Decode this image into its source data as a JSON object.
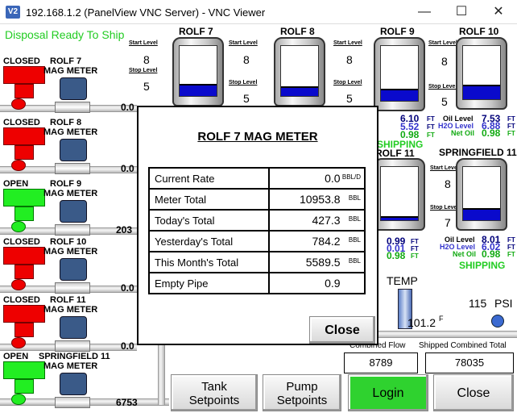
{
  "window": {
    "app_icon": "V2",
    "title": "192.168.1.2 (PanelView VNC Server) - VNC Viewer",
    "minimize": "—",
    "maximize": "☐",
    "close": "✕"
  },
  "status": "Disposal Ready To Ship",
  "valves": [
    {
      "state": "CLOSED",
      "meter": "ROLF 7",
      "meter2": "MAG METER",
      "flow": "0.0",
      "color": "red"
    },
    {
      "state": "CLOSED",
      "meter": "ROLF 8",
      "meter2": "MAG METER",
      "flow": "0.0",
      "color": "red"
    },
    {
      "state": "OPEN",
      "meter": "ROLF 9",
      "meter2": "MAG METER",
      "flow": "203",
      "color": "green"
    },
    {
      "state": "CLOSED",
      "meter": "ROLF 10",
      "meter2": "MAG METER",
      "flow": "0.0",
      "color": "red"
    },
    {
      "state": "CLOSED",
      "meter": "ROLF 11",
      "meter2": "MAG METER",
      "flow": "0.0",
      "color": "red"
    },
    {
      "state": "OPEN",
      "meter": "SPRINGFIELD 11",
      "meter2": "MAG METER",
      "flow": "6753",
      "color": "green"
    }
  ],
  "tanks": {
    "rolf7": {
      "title": "ROLF 7",
      "start_label": "Start Level",
      "start": "8",
      "stop_label": "Stop Level",
      "stop": "5",
      "fill_pct": 24
    },
    "rolf8": {
      "title": "ROLF 8",
      "start_label": "Start Level",
      "start": "8",
      "stop_label": "Stop Level",
      "stop": "5",
      "fill_pct": 20
    },
    "rolf9": {
      "title": "ROLF 9",
      "start_label": "Start Level",
      "start": "8",
      "stop_label": "Stop Level",
      "stop": "5",
      "fill_pct": 22,
      "oil_label": "Oil Level",
      "oil": "6.10",
      "h2o_label": "H2O Level",
      "h2o": "5.52",
      "net_label": "Net Oil",
      "net": "0.98",
      "unit": "FT",
      "ship": "SHIPPING"
    },
    "rolf10": {
      "title": "ROLF 10",
      "start_label": "Start Level",
      "start": "8",
      "stop_label": "Stop Level",
      "stop": "5",
      "fill_pct": 28,
      "oil_label": "Oil Level",
      "oil": "7.53",
      "h2o_label": "H2O Level",
      "h2o": "6.88",
      "net_label": "Net Oil",
      "net": "0.98",
      "unit": "FT"
    },
    "rolf11": {
      "title": "ROLF 11",
      "fill_pct": 8,
      "oil": "0.99",
      "h2o": "0.01",
      "net": "0.98",
      "unit": "FT"
    },
    "springfield11": {
      "title": "SPRINGFIELD 11",
      "start_label": "Start Level",
      "start": "8",
      "stop_label": "Stop Level",
      "stop": "7",
      "fill_pct": 22,
      "oil_label": "Oil Level",
      "oil": "8.01",
      "h2o_label": "H2O Level",
      "h2o": "6.02",
      "net_label": "Net Oil",
      "net": "0.98",
      "unit": "FT",
      "ship": "SHIPPING"
    }
  },
  "temp": {
    "label": "TEMP",
    "value": "101.2",
    "unit": "F"
  },
  "pressure": {
    "value": "115",
    "unit": "PSI"
  },
  "totals": {
    "combined_label": "Combined Flow",
    "combined": "8789",
    "shipped_label": "Shipped Combined Total",
    "shipped": "78035"
  },
  "buttons": {
    "tank_setpoints": [
      "Tank",
      "Setpoints"
    ],
    "pump_setpoints": [
      "Pump",
      "Setpoints"
    ],
    "login": "Login",
    "close": "Close"
  },
  "popup": {
    "title": "ROLF 7 MAG METER",
    "rows": [
      {
        "label": "Current Rate",
        "value": "0.0",
        "unit": "BBL/D"
      },
      {
        "label": "Meter Total",
        "value": "10953.8",
        "unit": "BBL"
      },
      {
        "label": "Today's Total",
        "value": "427.3",
        "unit": "BBL"
      },
      {
        "label": "Yesterday's Total",
        "value": "784.2",
        "unit": "BBL"
      },
      {
        "label": "This Month's Total",
        "value": "5589.5",
        "unit": "BBL"
      },
      {
        "label": "Empty Pipe",
        "value": "0.9",
        "unit": ""
      }
    ],
    "close": "Close"
  }
}
